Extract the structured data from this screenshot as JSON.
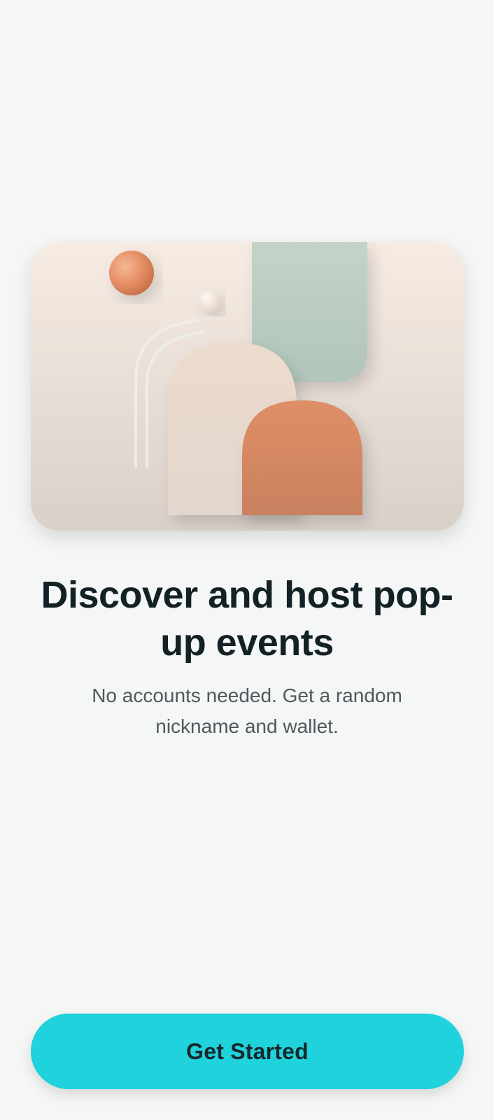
{
  "screen": "onboarding",
  "hero": {
    "illustration": "abstract-arches-and-spheres",
    "colors": {
      "terracotta": "#d48763",
      "sage": "#bfd0c6",
      "cream": "#e9dbcf",
      "background_top": "#f7ece3",
      "background_bottom": "#d9d0ca"
    }
  },
  "onboarding": {
    "headline": "Discover and host pop-up events",
    "subtitle": "No accounts needed. Get a random nickname and wallet."
  },
  "actions": {
    "get_started_label": "Get Started"
  },
  "theme": {
    "page_background": "#f5f6f6",
    "accent": "#1fd2dc",
    "headline_color": "#132125",
    "subtitle_color": "#4d5a5d"
  }
}
